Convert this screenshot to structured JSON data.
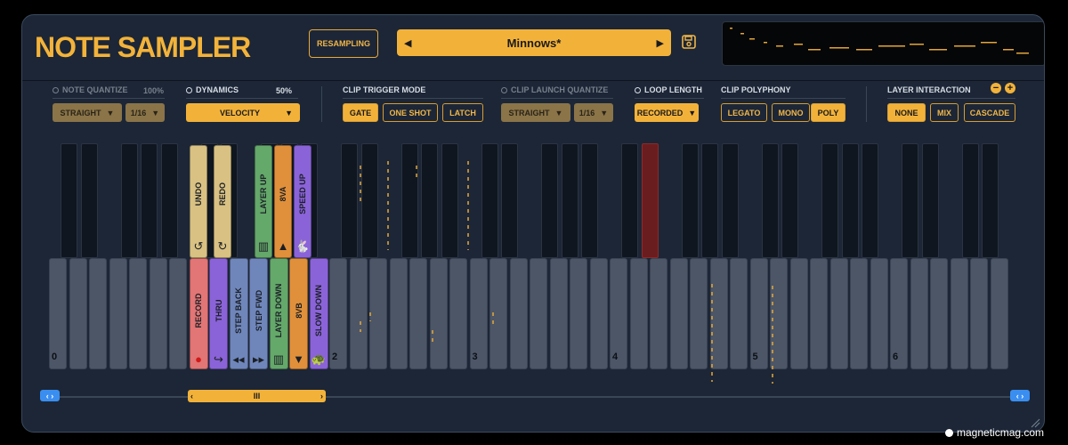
{
  "header": {
    "title": "NOTE SAMPLER",
    "resampling": "RESAMPLING",
    "preset": "Minnows*",
    "prev_icon": "triangle-left",
    "next_icon": "triangle-right",
    "save_icon": "floppy-disk"
  },
  "controls": {
    "note_quantize": {
      "label": "NOTE QUANTIZE",
      "value": "100%",
      "mode": "STRAIGHT",
      "rate": "1/16"
    },
    "dynamics": {
      "label": "DYNAMICS",
      "value": "50%",
      "mode": "VELOCITY"
    },
    "clip_trigger": {
      "label": "CLIP TRIGGER MODE",
      "options": [
        "GATE",
        "ONE SHOT",
        "LATCH"
      ],
      "active": "GATE"
    },
    "clip_launch": {
      "label": "CLIP LAUNCH QUANTIZE",
      "mode": "STRAIGHT",
      "rate": "1/16"
    },
    "loop_length": {
      "label": "LOOP LENGTH",
      "mode": "RECORDED"
    },
    "polyphony": {
      "label": "CLIP POLYPHONY",
      "options": [
        "LEGATO",
        "MONO",
        "POLY"
      ],
      "active": "POLY"
    },
    "layer": {
      "label": "LAYER INTERACTION",
      "options": [
        "NONE",
        "MIX",
        "CASCADE"
      ],
      "active": "NONE"
    }
  },
  "keyboard": {
    "octave_labels": [
      "0",
      "2",
      "3",
      "4",
      "5",
      "6"
    ],
    "commands_top": [
      {
        "label": "UNDO",
        "icon": "↺",
        "color": "#d8c182"
      },
      {
        "label": "REDO",
        "icon": "↻",
        "color": "#d8c182"
      },
      {
        "label": "LAYER UP",
        "icon": "▥",
        "color": "#64a86a"
      },
      {
        "label": "8VA",
        "icon": "▲",
        "color": "#e0903a"
      },
      {
        "label": "SPEED UP",
        "icon": "🐇",
        "color": "#8a63d8"
      }
    ],
    "commands_bottom": [
      {
        "label": "RECORD",
        "icon": "●",
        "color": "#e27575"
      },
      {
        "label": "THRU",
        "icon": "↪",
        "color": "#8a63d8"
      },
      {
        "label": "STEP BACK",
        "icon": "◂◂",
        "color": "#6f86bb"
      },
      {
        "label": "STEP FWD",
        "icon": "▸▸",
        "color": "#6f86bb"
      },
      {
        "label": "LAYER DOWN",
        "icon": "▥",
        "color": "#64a86a"
      },
      {
        "label": "8VB",
        "icon": "▼",
        "color": "#e0903a"
      },
      {
        "label": "SLOW DOWN",
        "icon": "🐢",
        "color": "#8a63d8"
      }
    ]
  },
  "scroll": {
    "left": "‹ ›",
    "right": "‹ ›",
    "thumb_grip": "III",
    "thumb_left": "‹",
    "thumb_right": "›"
  },
  "watermark": "magneticmag.com"
}
